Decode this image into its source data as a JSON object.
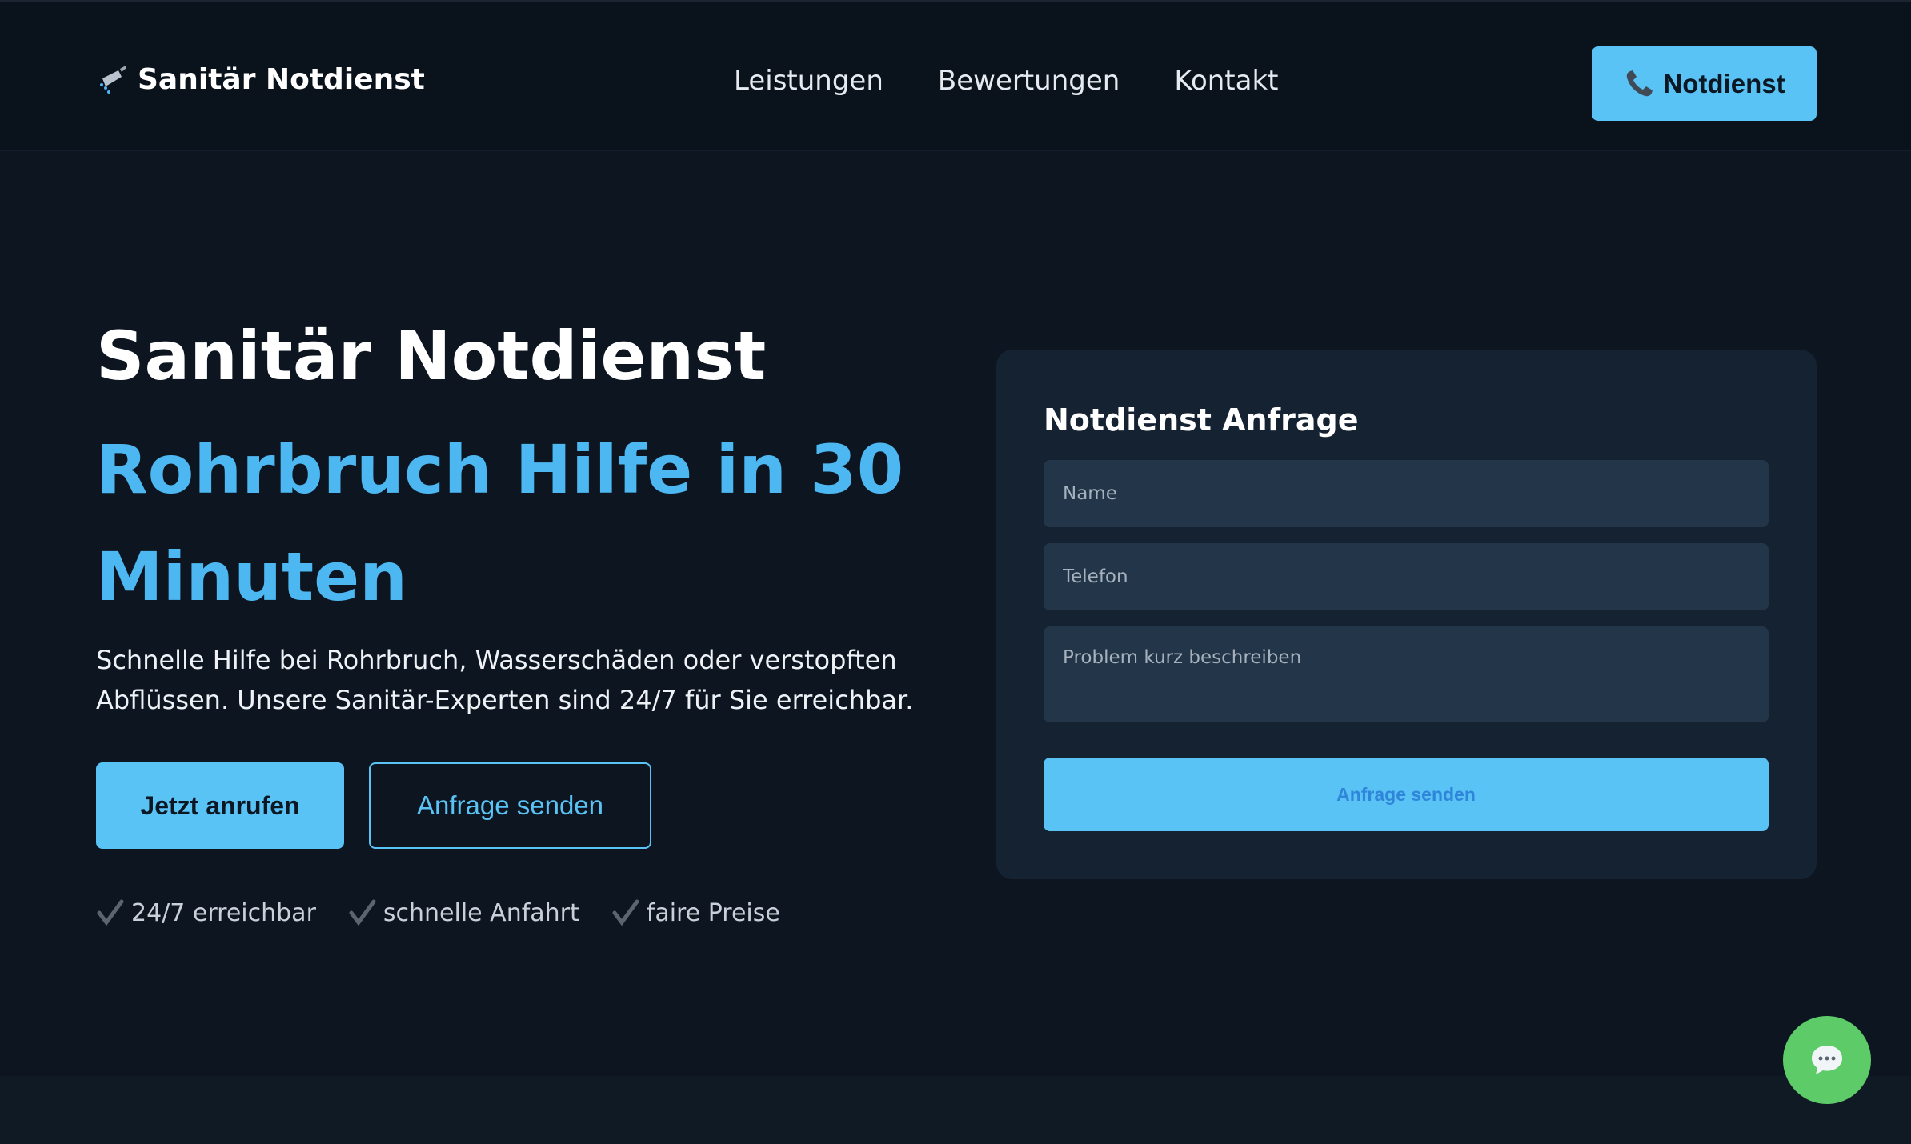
{
  "nav": {
    "brand": "Sanitär Notdienst",
    "links": [
      "Leistungen",
      "Bewertungen",
      "Kontakt"
    ],
    "cta": "Notdienst"
  },
  "hero": {
    "title": "Sanitär Notdienst",
    "subtitle": "Rohrbruch Hilfe in 30 Minuten",
    "lead": "Schnelle Hilfe bei Rohrbruch, Wasserschäden oder verstopften Abflüssen. Unsere Sanitär-Experten sind 24/7 für Sie erreichbar.",
    "primary_button": "Jetzt anrufen",
    "secondary_button": "Anfrage senden",
    "features": [
      "24/7 erreichbar",
      "schnelle Anfahrt",
      "faire Preise"
    ]
  },
  "form": {
    "title": "Notdienst Anfrage",
    "name_placeholder": "Name",
    "phone_placeholder": "Telefon",
    "message_placeholder": "Problem kurz beschreiben",
    "submit": "Anfrage senden"
  },
  "colors": {
    "accent": "#5ac3f6",
    "heading_blue": "#4db7f2",
    "background": "#0c1520",
    "card": "#152232",
    "chat": "#5ccb68"
  },
  "icons": {
    "logo": "shower-head-icon",
    "nav_cta": "phone-icon",
    "feature": "check-icon",
    "chat": "chat-bubble-icon"
  }
}
